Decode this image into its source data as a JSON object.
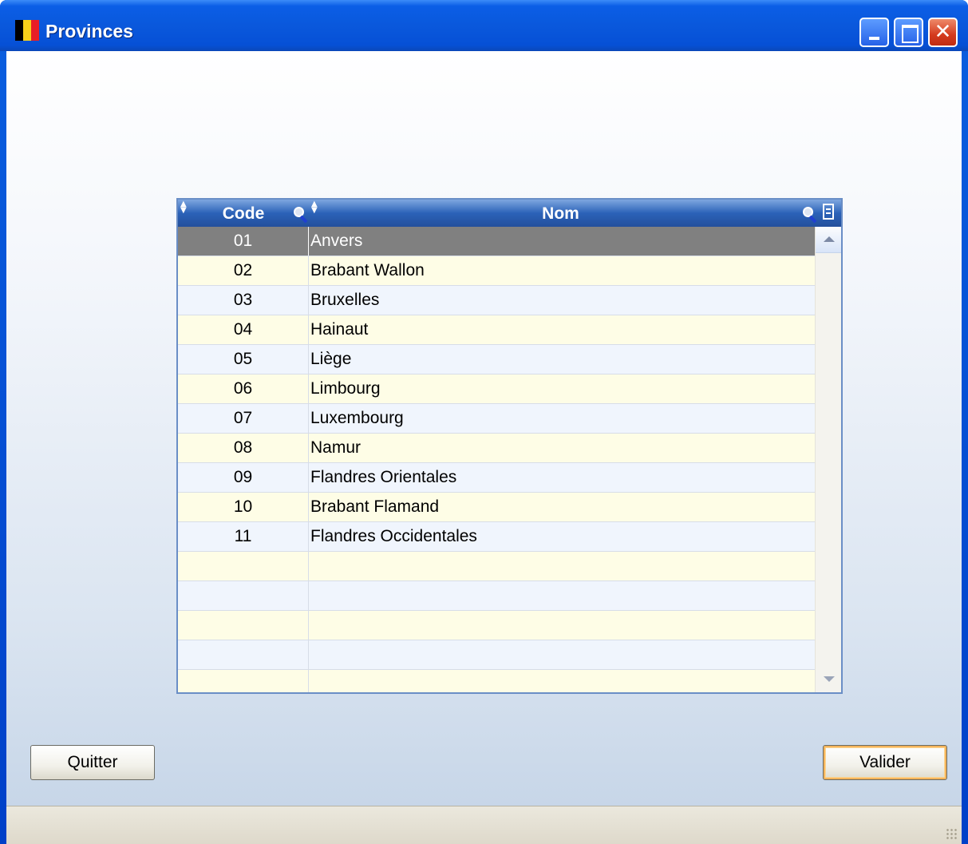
{
  "window": {
    "title": "Provinces",
    "icon": "belgium-flag-icon",
    "controls": [
      "minimize",
      "maximize",
      "close"
    ]
  },
  "grid": {
    "columns": [
      {
        "label": "Code"
      },
      {
        "label": "Nom"
      }
    ],
    "selected_row": 0,
    "rows": [
      {
        "code": "01",
        "name": "Anvers"
      },
      {
        "code": "02",
        "name": "Brabant Wallon"
      },
      {
        "code": "03",
        "name": "Bruxelles"
      },
      {
        "code": "04",
        "name": "Hainaut"
      },
      {
        "code": "05",
        "name": "Liège"
      },
      {
        "code": "06",
        "name": "Limbourg"
      },
      {
        "code": "07",
        "name": "Luxembourg"
      },
      {
        "code": "08",
        "name": "Namur"
      },
      {
        "code": "09",
        "name": "Flandres Orientales"
      },
      {
        "code": "10",
        "name": "Brabant Flamand"
      },
      {
        "code": "11",
        "name": "Flandres Occidentales"
      }
    ],
    "empty_rows": 5
  },
  "buttons": {
    "quit": "Quitter",
    "validate": "Valider"
  },
  "colors": {
    "titlebar": "#0a58dc",
    "header": "#2b62b8",
    "row_even": "#f0f5fd",
    "row_odd": "#fefde6",
    "row_selected": "#808080",
    "default_button_focus": "#f5b45a"
  }
}
